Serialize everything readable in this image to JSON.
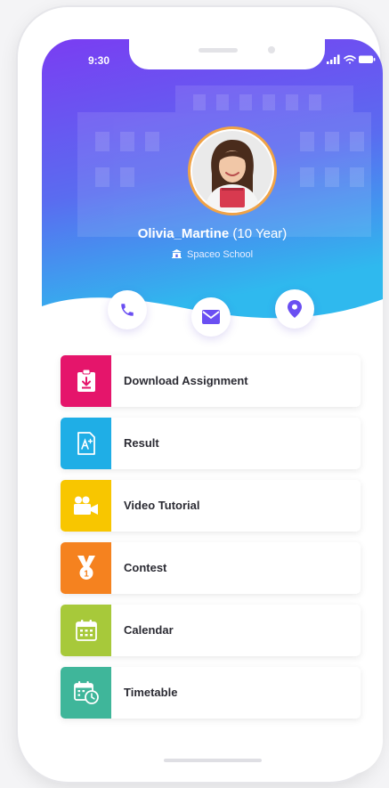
{
  "status_bar": {
    "time": "9:30"
  },
  "profile": {
    "name": "Olivia_Martine",
    "age": "(10 Year)",
    "school": "Spaceo School"
  },
  "actions": [
    {
      "icon": "phone-icon",
      "color": "#6a4ff2"
    },
    {
      "icon": "mail-icon",
      "color": "#6a4ff2"
    },
    {
      "icon": "location-pin-icon",
      "color": "#6a4ff2"
    }
  ],
  "menu": [
    {
      "label": "Download Assignment",
      "color": "#e5156b",
      "icon": "clipboard-download-icon"
    },
    {
      "label": "Result",
      "color": "#1faee6",
      "icon": "result-document-icon"
    },
    {
      "label": "Video Tutorial",
      "color": "#f8c600",
      "icon": "video-camera-icon"
    },
    {
      "label": "Contest",
      "color": "#f5821f",
      "icon": "medal-icon"
    },
    {
      "label": "Calendar",
      "color": "#a7c93a",
      "icon": "calendar-icon"
    },
    {
      "label": "Timetable",
      "color": "#3fb69a",
      "icon": "timetable-icon"
    }
  ],
  "colors": {
    "gradient_top": "#7a3df2",
    "gradient_bottom": "#2fb9ee",
    "accent": "#6a4ff2"
  }
}
